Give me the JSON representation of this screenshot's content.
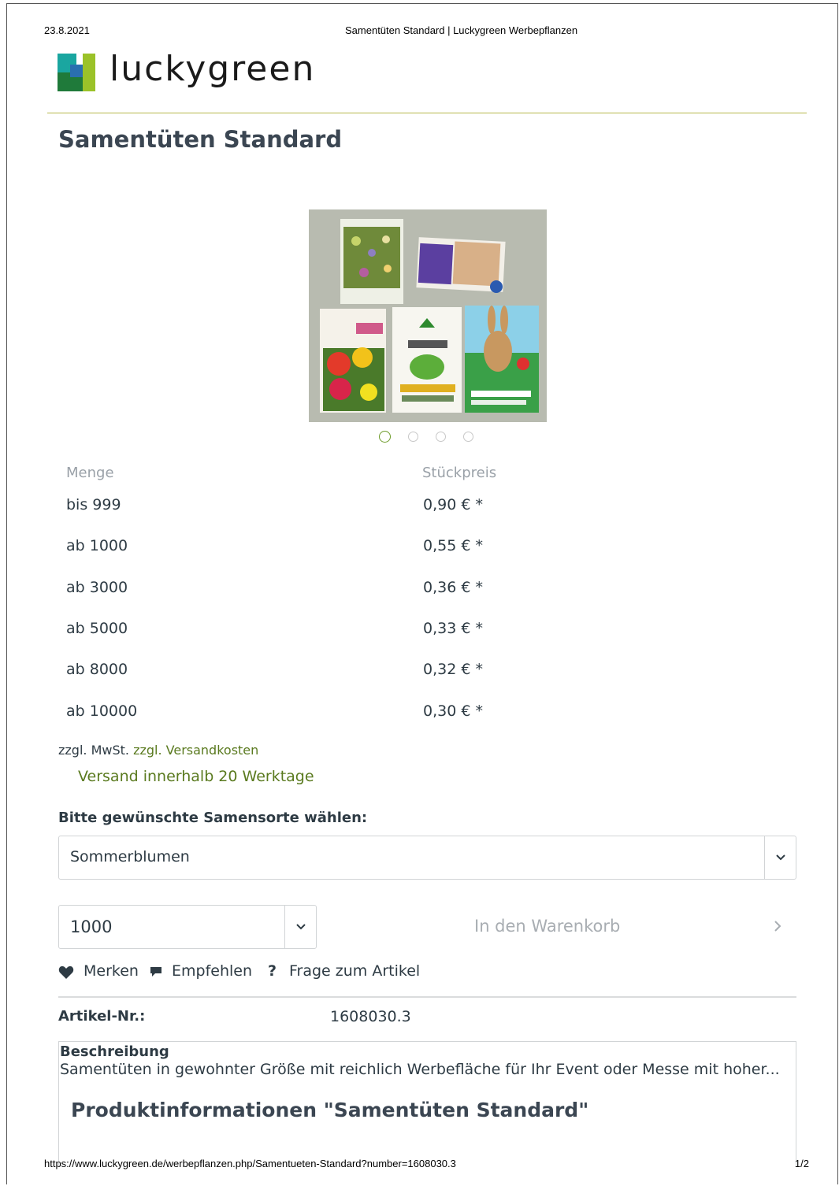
{
  "print_header": {
    "date": "23.8.2021",
    "title": "Samentüten Standard | Luckygreen Werbepflanzen"
  },
  "print_footer": {
    "url": "https://www.luckygreen.de/werbepflanzen.php/Samentueten-Standard?number=1608030.3",
    "page": "1/2"
  },
  "brand": {
    "name": "luckygreen",
    "colors": {
      "dark_green": "#1f7a3a",
      "teal": "#1aa6a0",
      "lime": "#9bc229",
      "blue": "#2a6fb0"
    }
  },
  "product": {
    "title": "Samentüten Standard",
    "image_icon": "seed-packets-photo",
    "slider_count": 4,
    "slider_active": 0
  },
  "price_table": {
    "headers": {
      "quantity": "Menge",
      "unit_price": "Stückpreis"
    },
    "rows": [
      {
        "qty": "bis 999",
        "price": "0,90 € *"
      },
      {
        "qty": "ab 1000",
        "price": "0,55 € *"
      },
      {
        "qty": "ab 3000",
        "price": "0,36 € *"
      },
      {
        "qty": "ab 5000",
        "price": "0,33 € *"
      },
      {
        "qty": "ab 8000",
        "price": "0,32 € *"
      },
      {
        "qty": "ab 10000",
        "price": "0,30 € *"
      }
    ]
  },
  "tax": {
    "prefix": "zzgl. MwSt.",
    "shipping_link": "zzgl. Versandkosten"
  },
  "delivery": "Versand innerhalb 20 Werktage",
  "variant": {
    "label": "Bitte gewünschte Samensorte wählen:",
    "selected": "Sommerblumen"
  },
  "quantity_select": {
    "selected": "1000"
  },
  "cart": {
    "label": "In den Warenkorb"
  },
  "actions": {
    "remember": "Merken",
    "recommend": "Empfehlen",
    "question": "Frage zum Artikel"
  },
  "sku": {
    "label": "Artikel-Nr.:",
    "value": "1608030.3"
  },
  "description": {
    "heading": "Beschreibung",
    "text": "Samentüten in gewohnter Größe mit reichlich Werbefläche für Ihr Event oder Messe mit hoher...",
    "subtitle": "Produktinformationen \"Samentüten Standard\""
  }
}
